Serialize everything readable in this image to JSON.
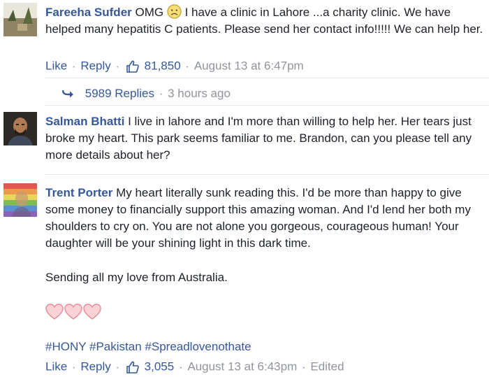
{
  "comments": [
    {
      "author": "Fareeha Sufder",
      "text_before_emoji": "OMG",
      "emoji_icon": "frown-emoji-icon",
      "text": "I have a clinic in Lahore ...a charity clinic. We have helped many hepatitis C patients. Please send her contact info!!!!! We can help her.",
      "like_label": "Like",
      "reply_label": "Reply",
      "likes_count": "81,850",
      "timestamp": "August 13 at 6:47pm"
    },
    {
      "author": "Salman Bhatti",
      "text": "I live in lahore and I'm more than willing to help her. Her tears just broke my heart. This park seems familiar to me. Brandon, can you please tell any more details about her?"
    },
    {
      "author": "Trent Porter",
      "text": "My heart literally sunk reading this. I'd be more than happy to give some money to financially support this amazing woman. And I'd lend her both my shoulders to cry on. You are not alone you gorgeous, courageous human! Your daughter will be your shining light in this dark time.",
      "text2": "Sending all my love from Australia.",
      "hearts_icon": "heart-icon",
      "hashtags": [
        "#HONY",
        "#Pakistan",
        "#Spreadlovenothate"
      ],
      "like_label": "Like",
      "reply_label": "Reply",
      "likes_count": "3,055",
      "timestamp": "August 13 at 6:43pm",
      "edited_label": "Edited"
    }
  ],
  "replies_link": {
    "label": "5989 Replies",
    "time": "3 hours ago"
  },
  "colors": {
    "link_blue": "#365899",
    "meta_gray": "#90949c",
    "heart_pink": "#f4b6bd"
  }
}
